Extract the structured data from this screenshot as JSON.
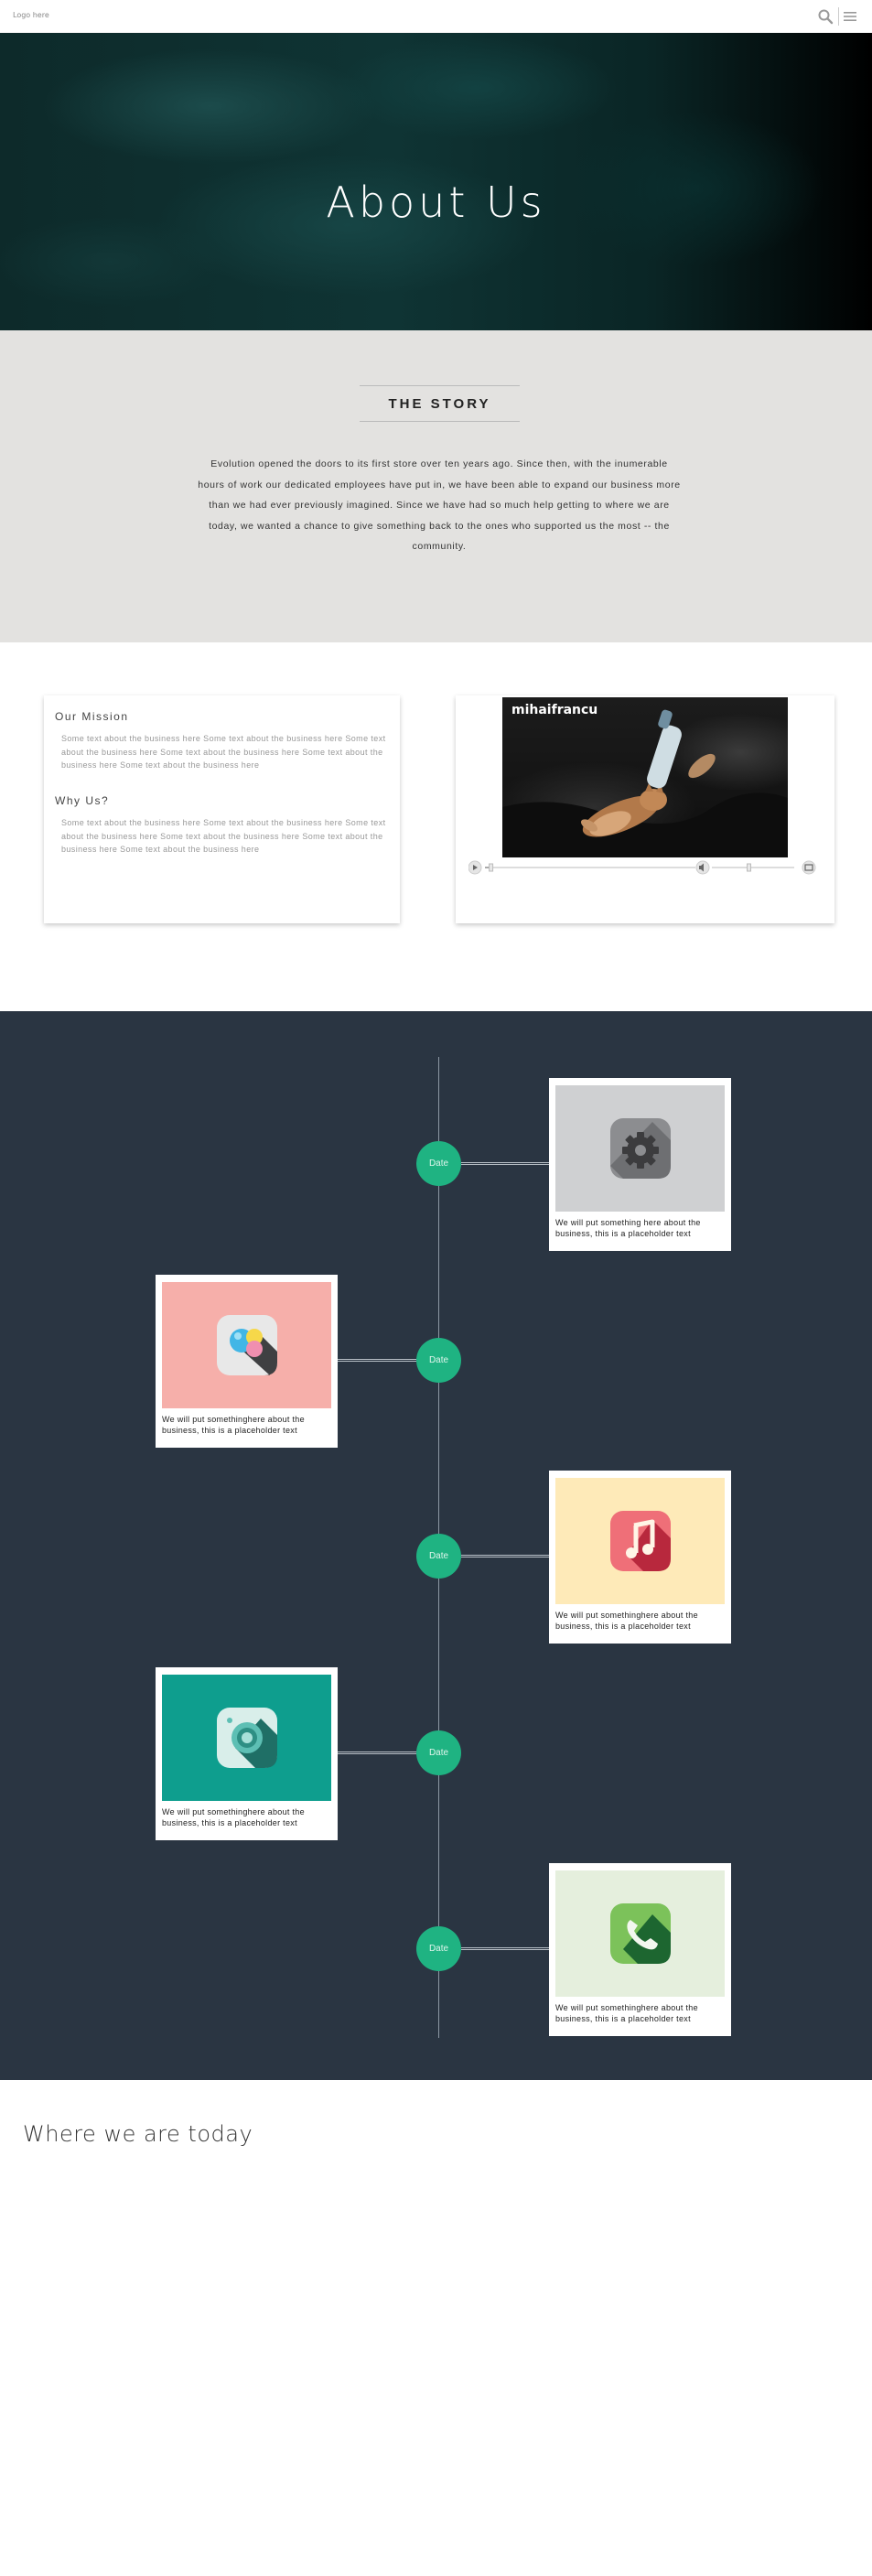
{
  "header": {
    "logo": "Logo here",
    "search_icon": "search-icon",
    "menu_icon": "hamburger-menu-icon"
  },
  "hero": {
    "title": "About Us"
  },
  "story": {
    "heading": "THE STORY",
    "body": "Evolution opened the doors to its first store over ten years ago. Since then, with the inumerable hours of work our dedicated employees have put in, we have been able to expand our business more than we had ever previously imagined. Since we have had so much help getting to where we are today, we wanted a chance to give something back to the ones who supported us the most -- the community."
  },
  "mission_card": {
    "mission_title": "Our Mission",
    "mission_text": "Some text about the business here Some text about the business here Some text about the business here Some text about the business here Some text about the business here Some text about the business here",
    "why_title": "Why Us?",
    "why_text": "Some text about the business here Some text about the business here Some text about the business here Some text about the business here Some text about the business here Some text about the business here"
  },
  "video": {
    "caption": "mihaifrancu",
    "progress": 0.02,
    "volume": 0.45
  },
  "timeline": {
    "items": [
      {
        "date": "Date",
        "text": "We will put something here about the business, this is a placeholder text",
        "icon": "settings-gear-icon",
        "bg": "#cfd0d2",
        "side": "right"
      },
      {
        "date": "Date",
        "text": "We will put somethinghere about the business, this is a placeholder text",
        "icon": "color-palette-icon",
        "bg": "#f6afaa",
        "side": "left"
      },
      {
        "date": "Date",
        "text": "We will put somethinghere about the business, this is a placeholder text",
        "icon": "music-note-icon",
        "bg": "#feeab8",
        "side": "right"
      },
      {
        "date": "Date",
        "text": "We will put somethinghere about the business, this is a placeholder text",
        "icon": "camera-icon",
        "bg": "#0e9e8e",
        "side": "left"
      },
      {
        "date": "Date",
        "text": "We will put somethinghere about the business, this is a placeholder text",
        "icon": "phone-icon",
        "bg": "#e5efdd",
        "side": "right"
      }
    ]
  },
  "today": {
    "title": "Where we are today"
  }
}
